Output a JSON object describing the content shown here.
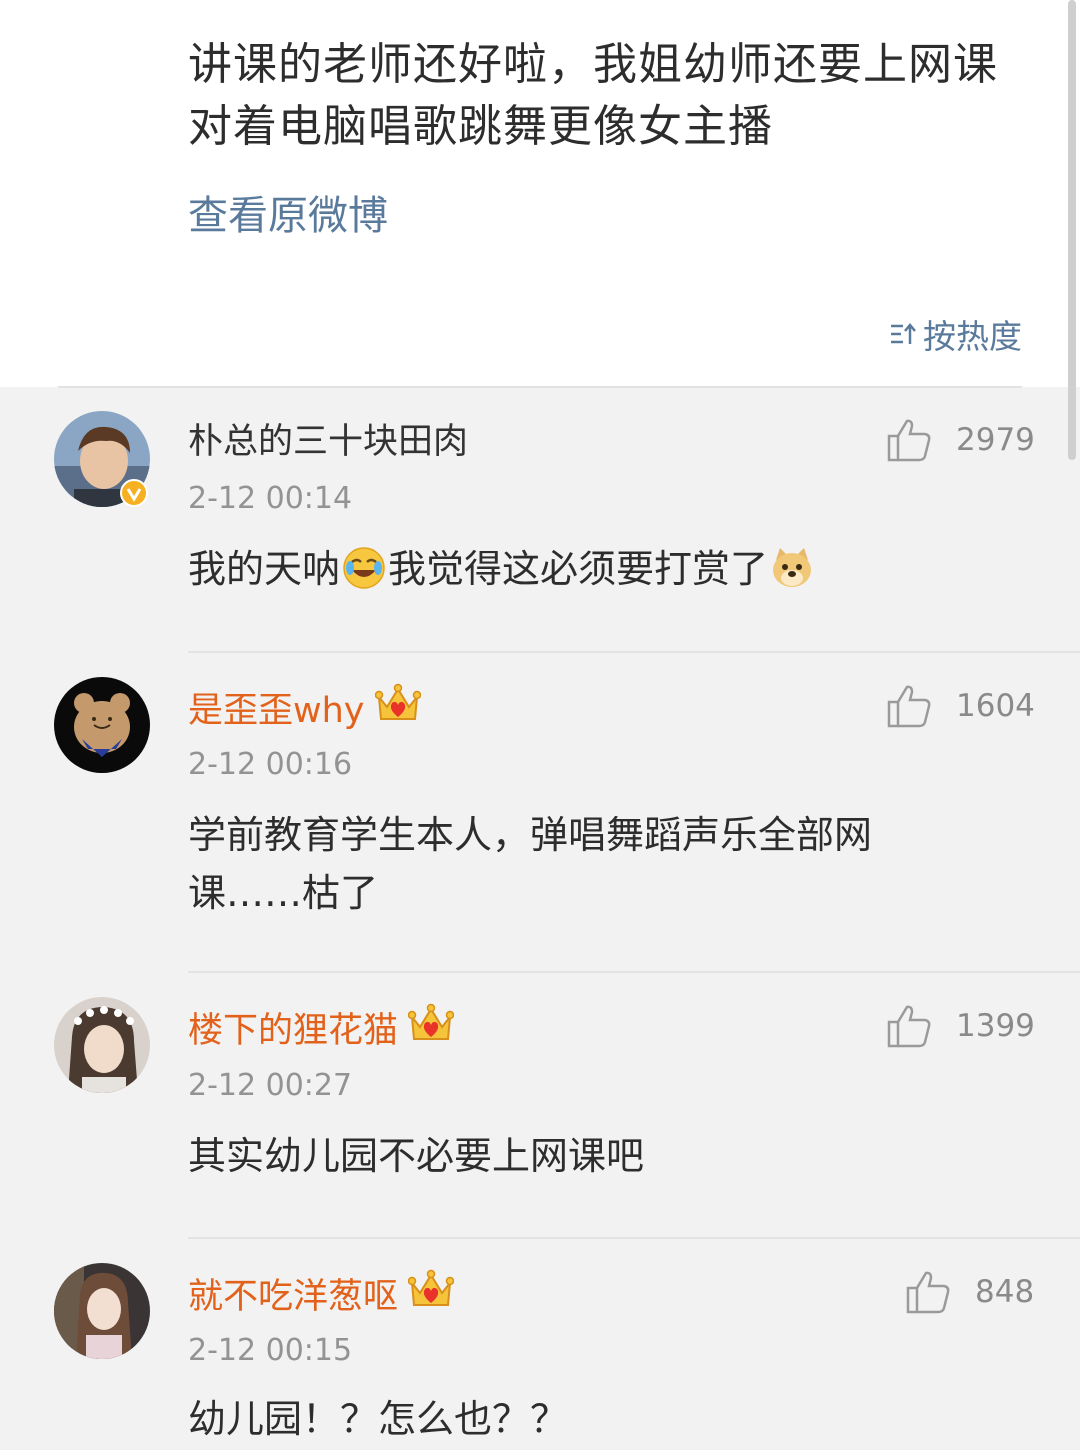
{
  "post": {
    "text": "讲课的老师还好啦，我姐幼师还要上网课对着电脑唱歌跳舞更像女主播",
    "view_original": "查看原微博",
    "sort_label": "按热度"
  },
  "comments": [
    {
      "user": "朴总的三十块田肉",
      "vip": false,
      "verified": true,
      "likes": "2979",
      "time": "2-12 00:14",
      "content_parts": [
        "我的天呐",
        "我觉得这必须要打赏了"
      ],
      "emojis": [
        "laugh-cry-emoji-icon",
        "doge-emoji-icon"
      ]
    },
    {
      "user": "是歪歪why",
      "vip": true,
      "likes": "1604",
      "time": "2-12 00:16",
      "content": "学前教育学生本人，弹唱舞蹈声乐全部网课……枯了"
    },
    {
      "user": "楼下的狸花猫",
      "vip": true,
      "likes": "1399",
      "time": "2-12 00:27",
      "content": "其实幼儿园不必要上网课吧"
    },
    {
      "user": "就不吃洋葱呕",
      "vip": true,
      "likes": "848",
      "time": "2-12 00:15",
      "content": "幼儿园！？怎么也？？"
    }
  ],
  "colors": {
    "vip_name": "#e2621b",
    "link": "#5a7a9c",
    "background": "#f2f2f2"
  },
  "icons": [
    "like-thumb-icon",
    "sort-icon",
    "vip-crown-icon",
    "verified-badge-icon"
  ]
}
